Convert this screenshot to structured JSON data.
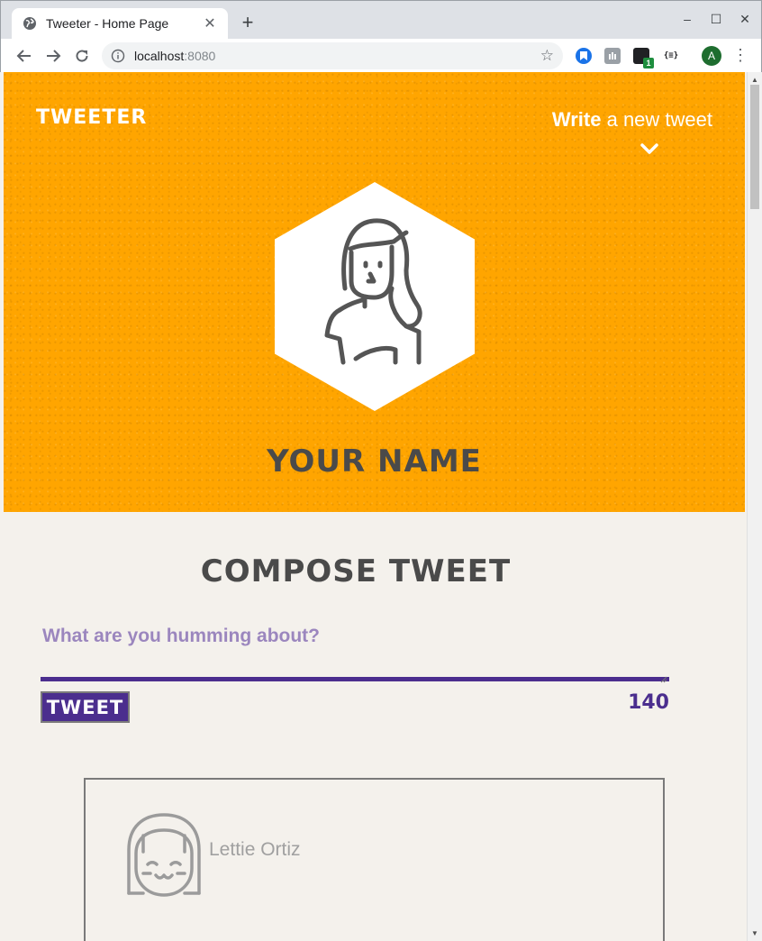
{
  "browser": {
    "tab_title": "Tweeter - Home Page",
    "tab_close": "✕",
    "new_tab": "+",
    "url_host": "localhost",
    "url_port": ":8080",
    "star": "☆",
    "ext_badge": "1",
    "ext_json": "{≡}",
    "profile_initial": "A",
    "menu": "⋮",
    "minimize": "–",
    "maximize": "☐",
    "close": "✕"
  },
  "header": {
    "brand": "Tweeter",
    "write_strong": "Write",
    "write_rest": " a new tweet",
    "profile_name": "YOUR NAME"
  },
  "compose": {
    "title": "COMPOSE TWEET",
    "placeholder": "What are you humming about?",
    "button_label": "TWEET",
    "counter": "140"
  },
  "tweets": [
    {
      "user": "Lettie Ortiz"
    }
  ],
  "colors": {
    "header_bg": "#ffa500",
    "page_bg": "#f4f1ec",
    "accent_purple": "#4b2e8e",
    "text_dark": "#4a4a4a"
  },
  "icons": {
    "tab": "globe-icon",
    "back": "back-arrow-icon",
    "forward": "forward-arrow-icon",
    "reload": "reload-icon",
    "info": "info-icon",
    "bookmark": "star-icon",
    "toggle": "chevron-down-icon",
    "avatar": "woman-avatar-icon",
    "tweet_avatar": "girl-avatar-icon"
  }
}
